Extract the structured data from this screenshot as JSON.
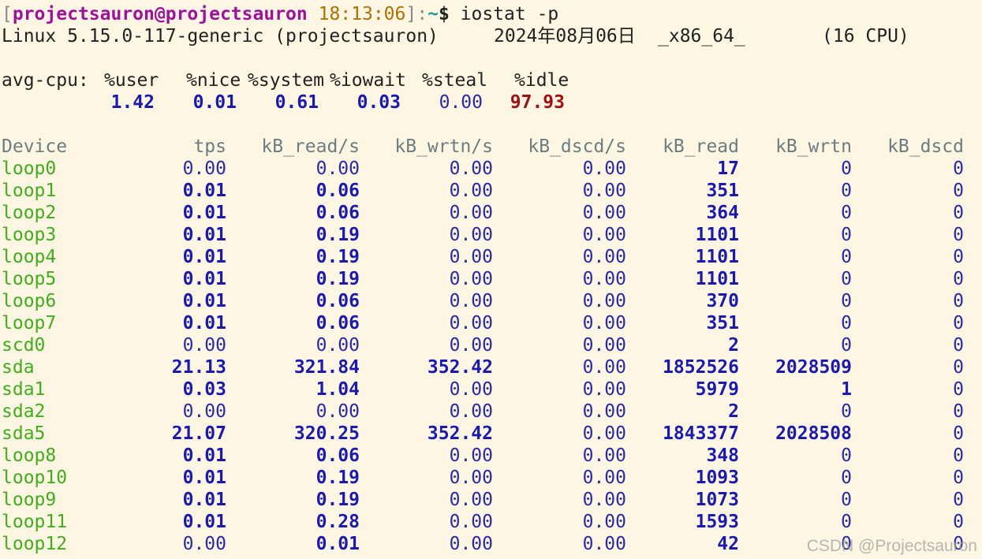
{
  "prompt": {
    "open_bracket": "[",
    "user_host": "projectsauron@projectsauron",
    "time": "18:13:06",
    "close_bracket": "]:",
    "path": "~",
    "dollar": "$",
    "command": "iostat -p"
  },
  "sysinfo": {
    "kernel": "Linux 5.15.0-117-generic (projectsauron)",
    "date": "2024年08月06日",
    "arch": "_x86_64_",
    "cpus": "(16 CPU)"
  },
  "avg_cpu": {
    "label": "avg-cpu:",
    "headers": [
      "%user",
      "%nice",
      "%system",
      "%iowait",
      "%steal",
      "%idle"
    ],
    "values": [
      "1.42",
      "0.01",
      "0.61",
      "0.03",
      "0.00",
      "97.93"
    ]
  },
  "devices": {
    "headers": [
      "Device",
      "tps",
      "kB_read/s",
      "kB_wrtn/s",
      "kB_dscd/s",
      "kB_read",
      "kB_wrtn",
      "kB_dscd"
    ],
    "rows": [
      [
        "loop0",
        "0.00",
        "0.00",
        "0.00",
        "0.00",
        "17",
        "0",
        "0"
      ],
      [
        "loop1",
        "0.01",
        "0.06",
        "0.00",
        "0.00",
        "351",
        "0",
        "0"
      ],
      [
        "loop2",
        "0.01",
        "0.06",
        "0.00",
        "0.00",
        "364",
        "0",
        "0"
      ],
      [
        "loop3",
        "0.01",
        "0.19",
        "0.00",
        "0.00",
        "1101",
        "0",
        "0"
      ],
      [
        "loop4",
        "0.01",
        "0.19",
        "0.00",
        "0.00",
        "1101",
        "0",
        "0"
      ],
      [
        "loop5",
        "0.01",
        "0.19",
        "0.00",
        "0.00",
        "1101",
        "0",
        "0"
      ],
      [
        "loop6",
        "0.01",
        "0.06",
        "0.00",
        "0.00",
        "370",
        "0",
        "0"
      ],
      [
        "loop7",
        "0.01",
        "0.06",
        "0.00",
        "0.00",
        "351",
        "0",
        "0"
      ],
      [
        "scd0",
        "0.00",
        "0.00",
        "0.00",
        "0.00",
        "2",
        "0",
        "0"
      ],
      [
        "sda",
        "21.13",
        "321.84",
        "352.42",
        "0.00",
        "1852526",
        "2028509",
        "0"
      ],
      [
        "sda1",
        "0.03",
        "1.04",
        "0.00",
        "0.00",
        "5979",
        "1",
        "0"
      ],
      [
        "sda2",
        "0.00",
        "0.00",
        "0.00",
        "0.00",
        "2",
        "0",
        "0"
      ],
      [
        "sda5",
        "21.07",
        "320.25",
        "352.42",
        "0.00",
        "1843377",
        "2028508",
        "0"
      ],
      [
        "loop8",
        "0.01",
        "0.06",
        "0.00",
        "0.00",
        "348",
        "0",
        "0"
      ],
      [
        "loop10",
        "0.01",
        "0.19",
        "0.00",
        "0.00",
        "1093",
        "0",
        "0"
      ],
      [
        "loop9",
        "0.01",
        "0.19",
        "0.00",
        "0.00",
        "1073",
        "0",
        "0"
      ],
      [
        "loop11",
        "0.01",
        "0.28",
        "0.00",
        "0.00",
        "1593",
        "0",
        "0"
      ],
      [
        "loop12",
        "0.00",
        "0.01",
        "0.00",
        "0.00",
        "42",
        "0",
        "0"
      ]
    ]
  },
  "watermark": "CSDN @Projectsauron",
  "colors": {
    "background": "#fdf6e3",
    "user_host": "#a0109a",
    "time": "#b07000",
    "path": "#1f9aa0",
    "device": "#3fae1a",
    "number": "#1a1ab0",
    "idle": "#a01010",
    "header": "#6b7d80"
  }
}
